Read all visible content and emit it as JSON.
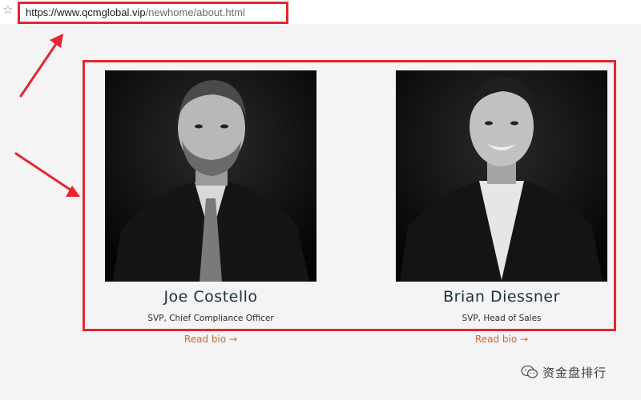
{
  "browser": {
    "url_host": "https://www.qcmglobal.vip",
    "url_path": "/newhome/about.html"
  },
  "team": [
    {
      "name": "Joe Costello",
      "title": "SVP, Chief Compliance Officer",
      "link": "Read bio"
    },
    {
      "name": "Brian Diessner",
      "title": "SVP, Head of Sales",
      "link": "Read bio"
    }
  ],
  "watermark": {
    "text": "资金盘排行",
    "icon": "wechat-icon"
  },
  "colors": {
    "annotation_red": "#e6252e",
    "name_color": "#173535",
    "link_color": "#d4692a",
    "background": "#f4f3f5"
  }
}
